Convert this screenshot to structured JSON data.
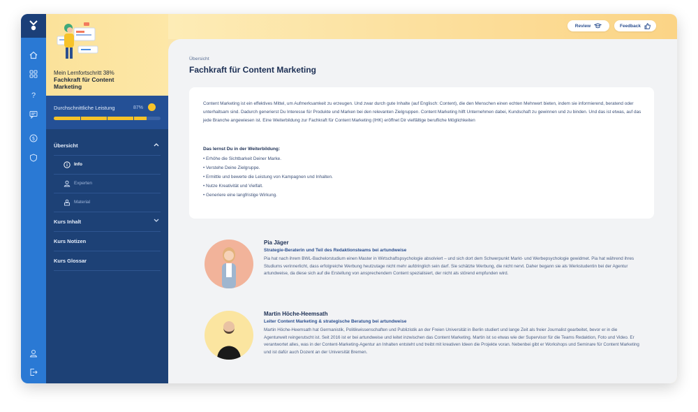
{
  "sidebar": {
    "progress_label": "Mein Lernfortschritt 38%",
    "progress_value": 0.38,
    "course_title": "Fachkraft für Content Marketing",
    "performance": {
      "label": "Durchschnittliche Leistung",
      "percent_text": "87%",
      "value": 0.87
    },
    "sections": [
      {
        "label": "Übersicht",
        "expanded": true
      },
      {
        "label": "Kurs Inhalt",
        "expanded": false
      },
      {
        "label": "Kurs Notizen"
      },
      {
        "label": "Kurs Glossar"
      }
    ],
    "subitems": [
      {
        "label": "Info",
        "icon": "info-icon",
        "active": true
      },
      {
        "label": "Experten",
        "icon": "experts-icon",
        "active": false
      },
      {
        "label": "Material",
        "icon": "material-icon",
        "active": false
      }
    ]
  },
  "rail": {
    "icons": [
      "home-icon",
      "grid-icon",
      "help-icon",
      "chat-icon",
      "dollar-icon",
      "shield-icon",
      "profile-icon",
      "logout-icon"
    ]
  },
  "topbar": {
    "review_label": "Review",
    "feedback_label": "Feedback"
  },
  "main": {
    "breadcrumb": "Übersicht",
    "title": "Fachkraft für Content Marketing",
    "intro": "Content Marketing ist ein effektives Mittel, um Aufmerksamkeit zu erzeugen. Und zwar durch gute Inhalte (auf Englisch: Content), die den Menschen einen echten Mehrwert bieten, indem sie informierend, beratend oder unterhaltsam sind. Dadurch generierst Du Interesse für Produkte und Marken bei den relevanten Zielgruppen. Content Marketing hilft Unternehmen dabei, Kundschaft zu gewinnen und zu binden. Und das ist etwas, auf das jede Branche angewiesen ist. Eine Weiterbildung zur Fachkraft für Content Marketing (IHK) eröffnet Dir vielfältige berufliche Möglichkeiten",
    "learn_title": "Das lernst Du in der Weiterbildung:",
    "learn_items": [
      "Erhöhe die Sichtbarkeit Deiner Marke.",
      "Verstehe Deine Zielgruppe.",
      "Ermittle und bewerte die Leistung von Kampagnen und Inhalten.",
      "Nutze Kreativität und Vielfalt.",
      "Generiere eine langfristige Wirkung."
    ],
    "experts": [
      {
        "name": "Pia Jäger",
        "role": "Strategie-Beraterin und Teil des Redaktionsteams bei artundweise",
        "bio": "Pia hat nach ihrem BWL-Bachelorstudium einen Master in Wirtschaftspsychologie absolviert – und sich dort dem Schwerpunkt Markt- und Werbepsychologie gewidmet. Pia hat während ihres Studiums verinnerlicht, dass erfolgreiche Werbung heutzutage nicht mehr aufdringlich sein darf. Sie schätzte Werbung, die nicht nervt. Daher begann sie als Werkstudentin bei der Agentur artundweise, da diese sich auf die Erstellung von ansprechendem Content spezialisiert, der nicht als störend empfunden wird.",
        "avatar_color": "#f2b39a"
      },
      {
        "name": "Martin Höche-Heemsath",
        "role": "Leiter Content Marketing & strategische Beratung bei artundweise",
        "bio": "Martin Höche-Heemsath hat Germanistik, Politikwissenschaften und Publizistik an der Freien Universität in Berlin studiert und lange Zeit als freier Journalist gearbeitet, bevor er in die Agenturwelt reingerutscht ist. Seit 2016 ist er bei artundweise und leitet inzwischen das Content Marketing. Martin ist so etwas wie der Supervisor für die Teams Redaktion, Foto und Video. Er verantwortet alles, was in der Content-Marketing-Agentur an Inhalten entsteht und treibt mit kreativen Ideen die Projekte voran. Nebenbei gibt er Workshops und Seminare für Content Marketing und ist dafür auch Dozent an der Universität Bremen.",
        "avatar_color": "#fbe5a0"
      }
    ]
  },
  "colors": {
    "rail": "#2a79d4",
    "sidebar": "#1d4176",
    "accent_yellow": "#f7c329",
    "title_navy": "#1c2f54"
  }
}
